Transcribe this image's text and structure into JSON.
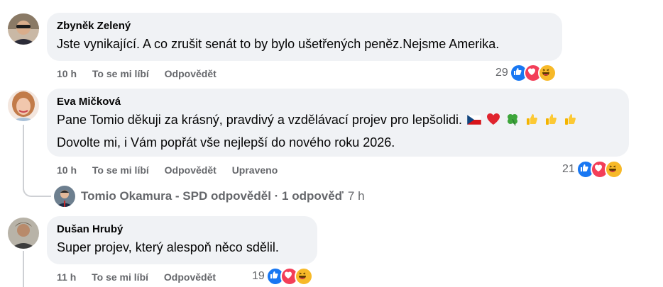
{
  "comments": [
    {
      "author": "Zbyněk Zelený",
      "text": "Jste vynikající. A co zrušit senát to by bylo ušetřených peněz.Nejsme Amerika.",
      "time": "10 h",
      "like_label": "To se mi líbí",
      "reply_label": "Odpovědět",
      "reaction_count": "29"
    },
    {
      "author": "Eva Mičková",
      "text_line1": "Pane Tomio děkuji za krásný, pravdivý a vzdělávací projev pro lepšolidi.",
      "text_line2": "Dovolte mi, i Vám popřát vše nejlepší do nového roku 2026.",
      "time": "10 h",
      "like_label": "To se mi líbí",
      "reply_label": "Odpovědět",
      "edited_label": "Upraveno",
      "reaction_count": "21"
    },
    {
      "author": "Dušan Hrubý",
      "text": "Super projev, který alespoň něco sdělil.",
      "time": "11 h",
      "like_label": "To se mi líbí",
      "reply_label": "Odpovědět",
      "reaction_count": "19"
    }
  ],
  "reply_summary": {
    "text": "Tomio Okamura - SPD odpověděl · 1 odpověď",
    "ago": "7 h"
  },
  "icons": {
    "like": "like-reaction-icon",
    "love": "love-reaction-icon",
    "haha": "haha-reaction-icon",
    "emojis": [
      "czech-flag",
      "red-heart",
      "four-leaf-clover",
      "thumbs-up",
      "thumbs-up",
      "thumbs-up"
    ]
  },
  "colors": {
    "bubble": "#f0f2f5",
    "meta": "#65676b",
    "like": "#1877f2",
    "love": "#f33e58",
    "haha": "#f7b928"
  }
}
